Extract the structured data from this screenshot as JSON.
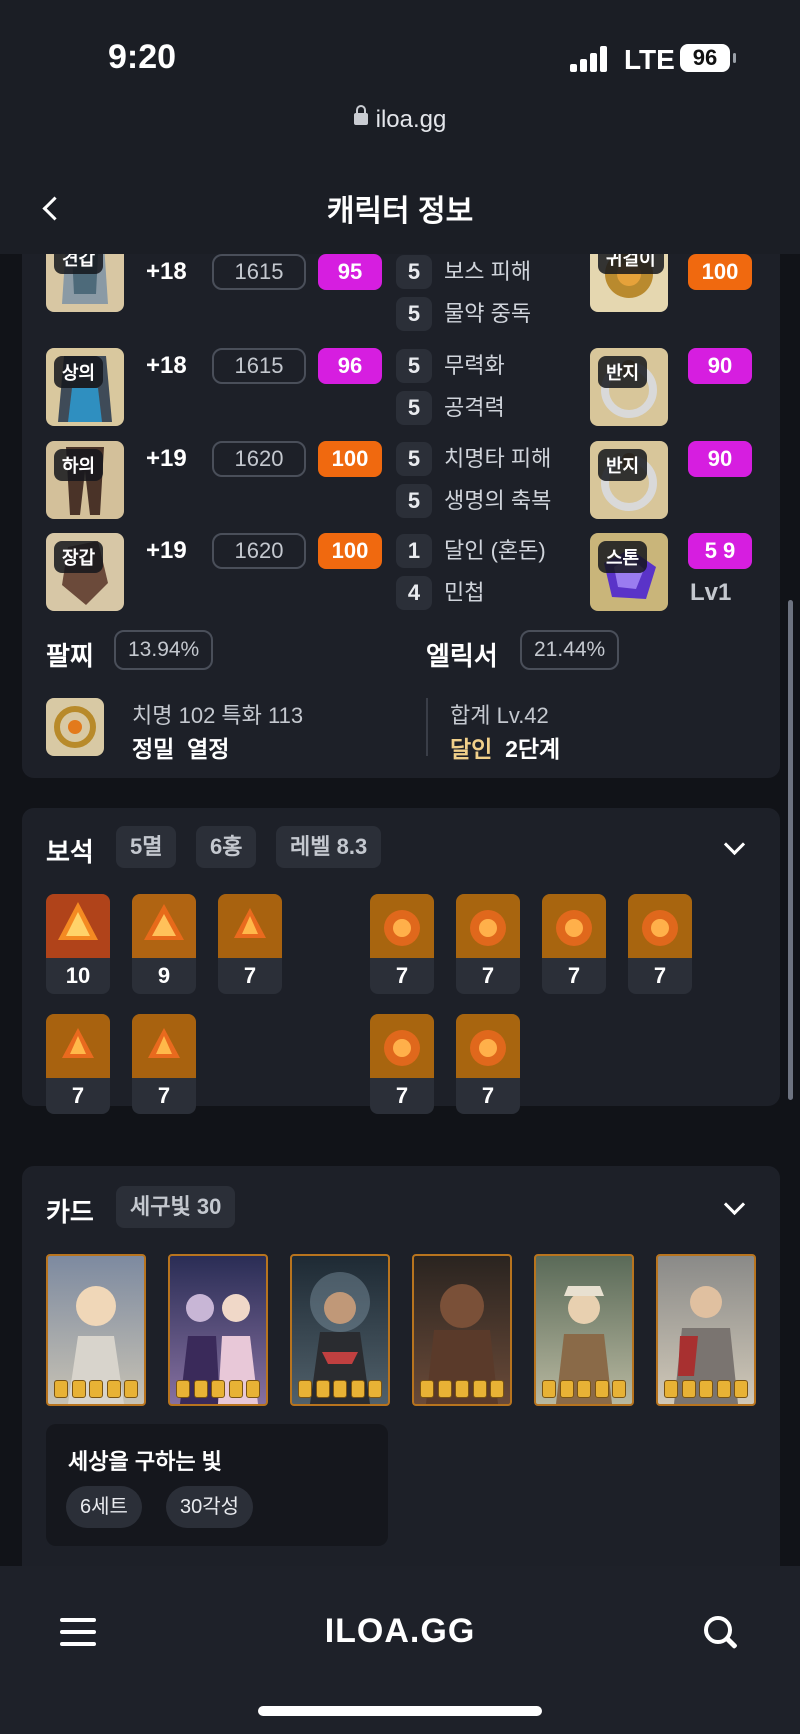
{
  "status": {
    "time": "9:20",
    "network": "LTE",
    "battery": "96"
  },
  "browser": {
    "url": "iloa.gg"
  },
  "header": {
    "title": "캐릭터 정보"
  },
  "equipment": [
    {
      "slot": "견갑",
      "plus": "+18",
      "ilvl": "1615",
      "quality": "95",
      "engravings": [
        {
          "lv": "5",
          "name": "보스 피해"
        },
        {
          "lv": "5",
          "name": "물약 중독"
        }
      ],
      "acc": {
        "slot": "귀걸이",
        "quality": "100"
      }
    },
    {
      "slot": "상의",
      "plus": "+18",
      "ilvl": "1615",
      "quality": "96",
      "engravings": [
        {
          "lv": "5",
          "name": "무력화"
        },
        {
          "lv": "5",
          "name": "공격력"
        }
      ],
      "acc": {
        "slot": "반지",
        "quality": "90"
      }
    },
    {
      "slot": "하의",
      "plus": "+19",
      "ilvl": "1620",
      "quality": "100",
      "engravings": [
        {
          "lv": "5",
          "name": "치명타 피해"
        },
        {
          "lv": "5",
          "name": "생명의 축복"
        }
      ],
      "acc": {
        "slot": "반지",
        "quality": "90"
      }
    },
    {
      "slot": "장갑",
      "plus": "+19",
      "ilvl": "1620",
      "quality": "100",
      "engravings": [
        {
          "lv": "1",
          "name": "달인 (혼돈)"
        },
        {
          "lv": "4",
          "name": "민첩"
        }
      ],
      "acc": {
        "slot": "스톤",
        "quality": "5 9",
        "level": "Lv1"
      }
    }
  ],
  "bracelet": {
    "title": "팔찌",
    "pct": "13.94%",
    "stats": "치명 102  특화 113",
    "effects": [
      "정밀",
      "열정"
    ]
  },
  "elixir": {
    "title": "엘릭서",
    "pct": "21.44%",
    "total": "합계 Lv.42",
    "set_name": "달인",
    "set_stage": "2단계"
  },
  "gems": {
    "title": "보석",
    "summary": [
      "5멸",
      "6홍",
      "레벨 8.3"
    ],
    "left": [
      "10",
      "9",
      "7",
      "7",
      "7"
    ],
    "right": [
      "7",
      "7",
      "7",
      "7",
      "7",
      "7"
    ]
  },
  "cards": {
    "title": "카드",
    "summary": "세구빛 30",
    "set_name": "세상을 구하는 빛",
    "chips": [
      "6세트",
      "30각성"
    ]
  },
  "bottom": {
    "brand": "ILOA.GG"
  },
  "colors": {
    "purple": "#d61ee0",
    "orange": "#f0690f",
    "accent_gold": "#f1d08a"
  }
}
